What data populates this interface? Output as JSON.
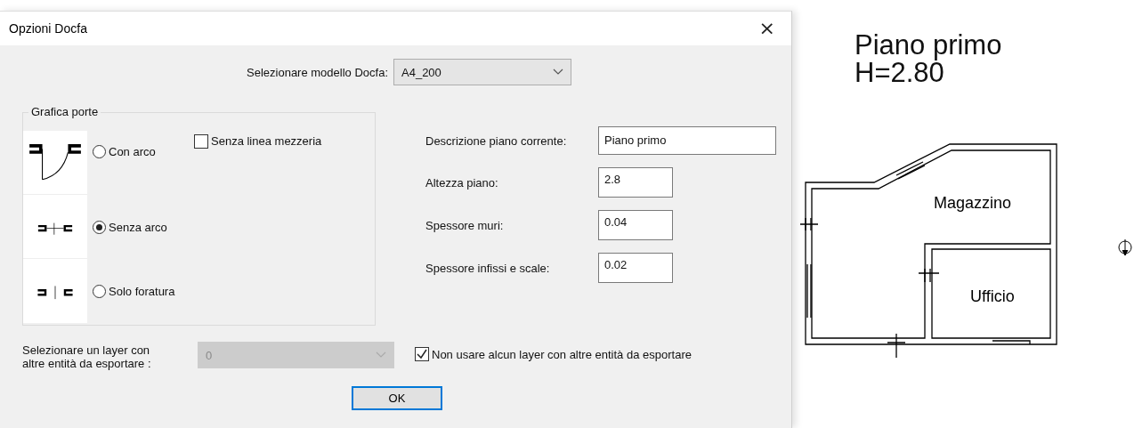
{
  "dialog": {
    "title": "Opzioni Docfa",
    "close": "×",
    "model": {
      "label": "Selezionare modello Docfa:",
      "value": "A4_200"
    },
    "door_group": {
      "title": "Grafica porte",
      "options": [
        {
          "label": "Con arco",
          "kind": "arc",
          "selected": false
        },
        {
          "label": "Senza arco",
          "kind": "line",
          "selected": true
        },
        {
          "label": "Solo foratura",
          "kind": "gap",
          "selected": false
        }
      ],
      "no_centerline": {
        "label": "Senza linea mezzeria",
        "checked": false
      }
    },
    "fields": [
      {
        "label": "Descrizione piano corrente:",
        "value": "Piano primo",
        "kind": "wide"
      },
      {
        "label": "Altezza piano:",
        "value": "2.8",
        "kind": "short"
      },
      {
        "label": "Spessore muri:",
        "value": "0.04",
        "kind": "short"
      },
      {
        "label": "Spessore infissi e scale:",
        "value": "0.02",
        "kind": "short"
      }
    ],
    "layer": {
      "label": "Selezionare un layer con\naltre entità da esportare :",
      "value": "0",
      "disabled": true
    },
    "no_layer": {
      "label": "Non usare alcun layer con altre entità da esportare",
      "checked": true
    },
    "ok": "OK"
  },
  "drawing": {
    "title_lines": [
      "Piano primo",
      "H=2.80"
    ],
    "rooms": [
      "Magazzino",
      "Ufficio"
    ]
  }
}
